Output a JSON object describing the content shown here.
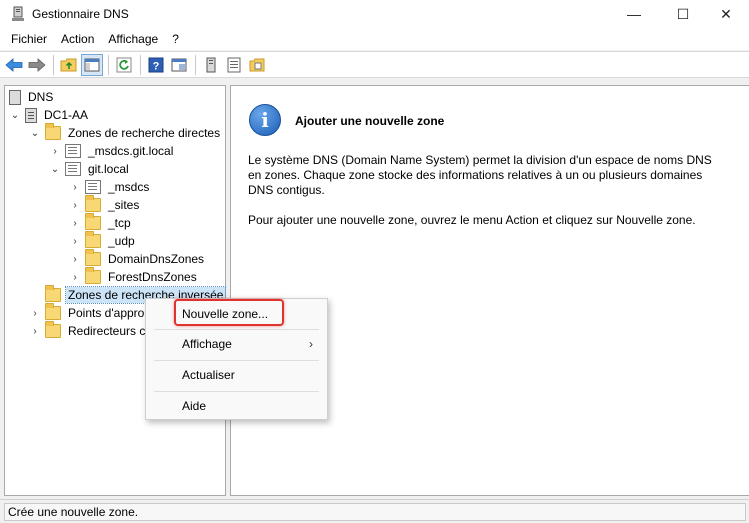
{
  "window": {
    "title": "Gestionnaire DNS",
    "minimize": "—",
    "maximize": "☐",
    "close": "✕"
  },
  "menu": [
    "Fichier",
    "Action",
    "Affichage",
    "?"
  ],
  "toolbar": {
    "buttons": [
      "back-arrow-icon",
      "forward-arrow-icon",
      "up-folder-icon",
      "show-hide-console-tree-icon",
      "refresh-icon",
      "help-icon",
      "properties-icon",
      "server-icon",
      "list-icon",
      "zone-folder-icon"
    ]
  },
  "tree": {
    "root": "DNS",
    "server": "DC1-AA",
    "forward_zones": "Zones de recherche directes",
    "msdcs_zone": "_msdcs.git.local",
    "git_zone": "git.local",
    "git_children": [
      "_msdcs",
      "_sites",
      "_tcp",
      "_udp",
      "DomainDnsZones",
      "ForestDnsZones"
    ],
    "reverse_zones": "Zones de recherche inversée",
    "trust_points": "Points d'approbation",
    "forwarders": "Redirecteurs conditionnels"
  },
  "info": {
    "title": "Ajouter une nouvelle zone",
    "paragraph1": "Le système DNS (Domain Name System) permet la division d'un espace de noms DNS en zones. Chaque zone stocke des informations relatives à un ou plusieurs domaines DNS contigus.",
    "paragraph2": "Pour ajouter une nouvelle zone, ouvrez le menu Action et cliquez sur Nouvelle zone."
  },
  "context_menu": {
    "new_zone": "Nouvelle zone...",
    "view": "Affichage",
    "refresh": "Actualiser",
    "help": "Aide",
    "submenu_arrow": "›"
  },
  "status": "Crée une nouvelle zone.",
  "colors": {
    "highlight": "#e0332f",
    "selection": "#cce4f7",
    "info_icon": "#1a5db5"
  }
}
